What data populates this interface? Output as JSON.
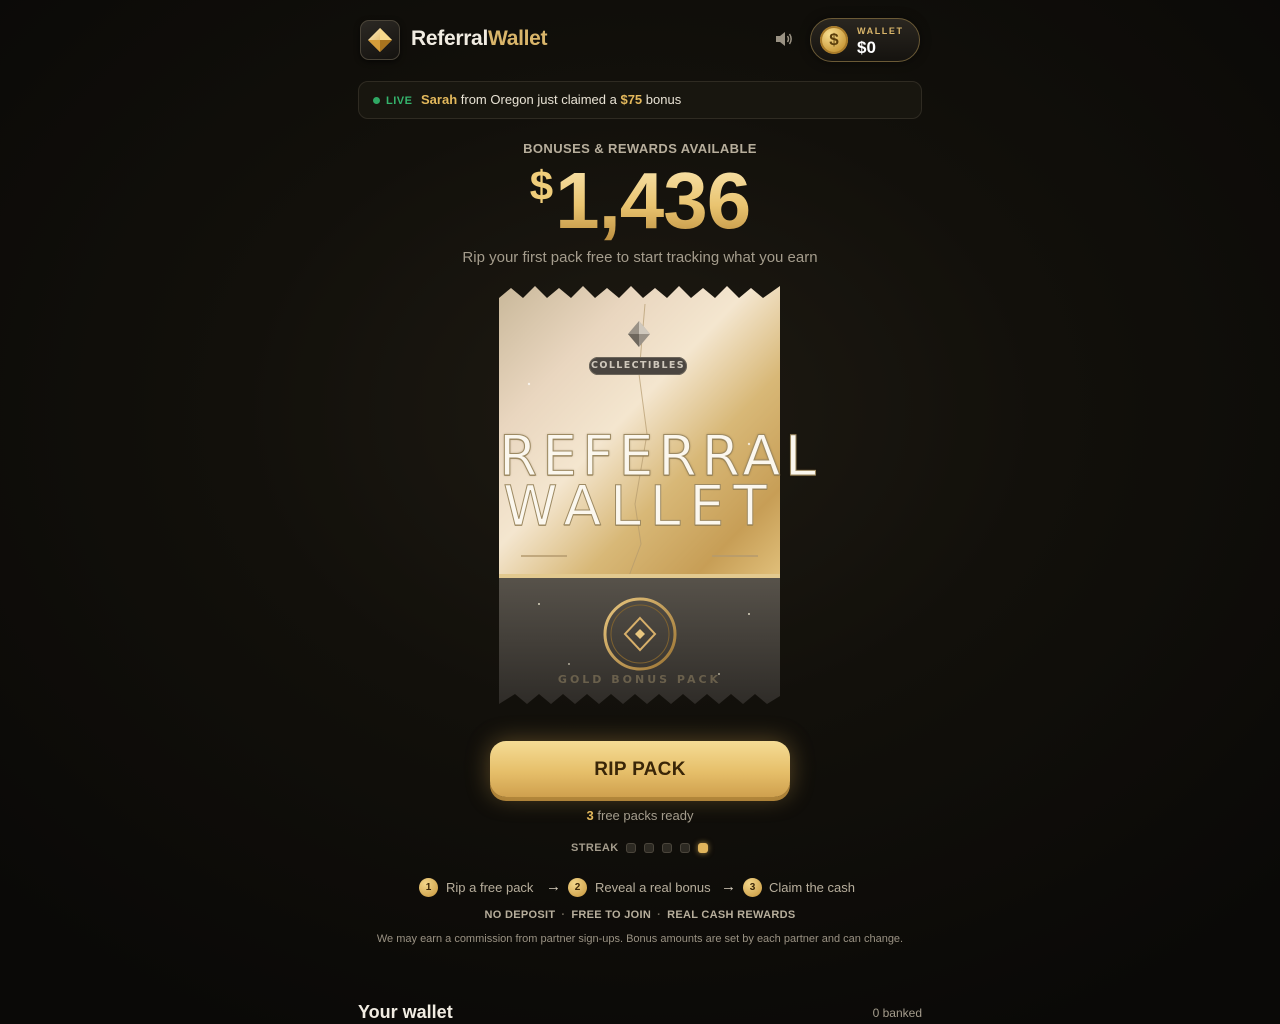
{
  "header": {
    "brand_part1": "Referral",
    "brand_part2": "Wallet",
    "wallet_label": "WALLET",
    "wallet_value": "$0",
    "coin_symbol": "$"
  },
  "live": {
    "label": "LIVE",
    "name": "Sarah",
    "text_middle": "from Oregon just claimed a",
    "amount": "$75",
    "text_end": "bonus"
  },
  "hero": {
    "label": "BONUSES & REWARDS AVAILABLE",
    "currency": "$",
    "amount": "1,436",
    "subtitle": "Rip your first pack free to start tracking what you earn"
  },
  "pack": {
    "tag": "COLLECTIBLES",
    "title_line1": "REFERRAL",
    "title_line2": "WALLET",
    "footer": "GOLD BONUS PACK"
  },
  "cta": {
    "button_label": "RIP PACK",
    "free_count": "3",
    "free_text": "free packs ready"
  },
  "streak": {
    "label": "STREAK",
    "total": 5,
    "filled": [
      false,
      false,
      false,
      false,
      true
    ]
  },
  "steps": [
    {
      "num": "1",
      "text": "Rip a free pack"
    },
    {
      "num": "2",
      "text": "Reveal a real bonus"
    },
    {
      "num": "3",
      "text": "Claim the cash"
    }
  ],
  "trust": [
    "NO DEPOSIT",
    "FREE TO JOIN",
    "REAL CASH REWARDS"
  ],
  "disclaimer": "We may earn a commission from partner sign-ups. Bonus amounts are set by each partner and can change.",
  "wallet_section": {
    "title": "Your wallet",
    "banked": "0 banked"
  },
  "colors": {
    "gold": "#e3b85c",
    "live_green": "#34b36c",
    "background": "#12100b"
  },
  "icons": {
    "logo": "diamond-gem-icon",
    "sound": "speaker-icon",
    "coin": "dollar-coin-icon"
  }
}
